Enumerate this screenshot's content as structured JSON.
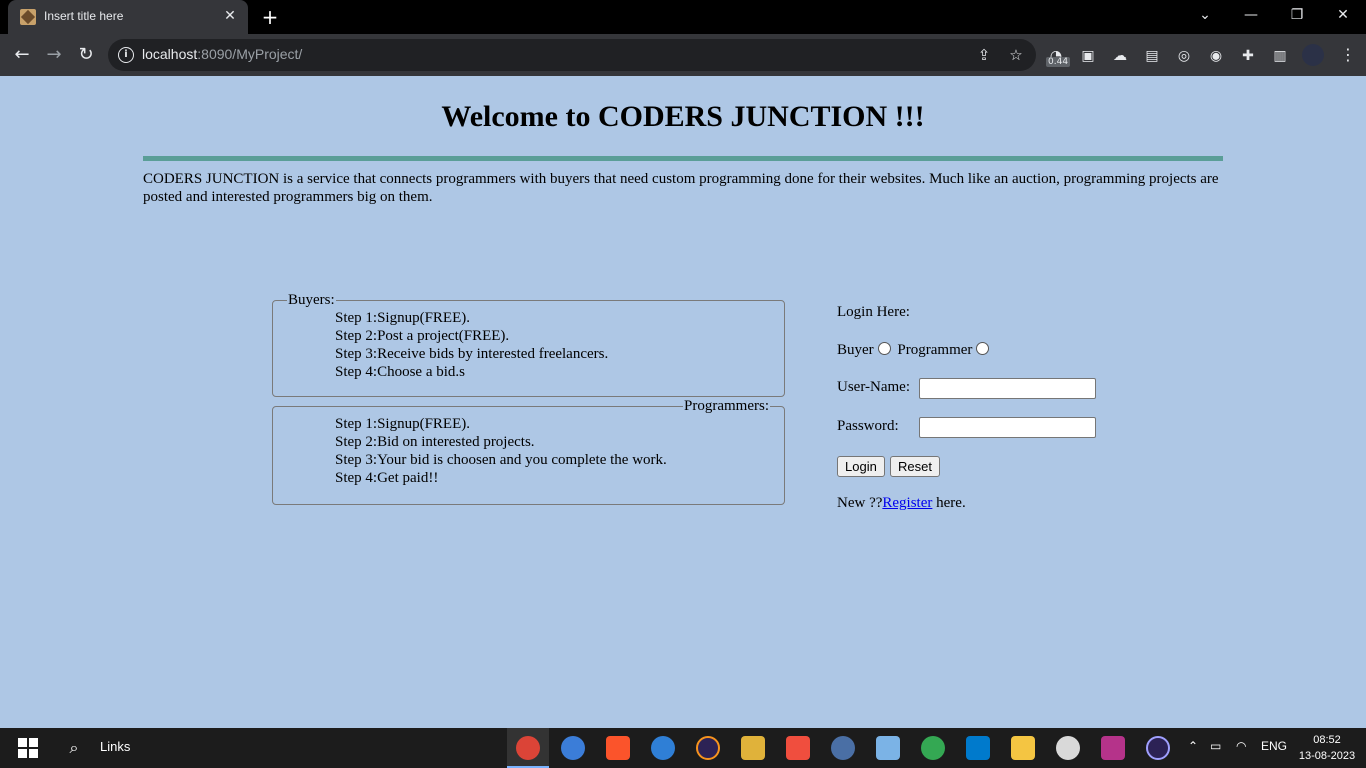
{
  "browser": {
    "tab_title": "Insert title here",
    "url_host": "localhost",
    "url_rest": ":8090/MyProject/",
    "extension_badge": "0.44"
  },
  "page": {
    "heading": "Welcome to CODERS JUNCTION !!!",
    "intro": "CODERS JUNCTION is a service that connects programmers with buyers that need custom programming done for their websites. Much like an auction, programming projects are posted and interested programmers big on them.",
    "buyers": {
      "legend": "Buyers:",
      "steps": [
        "Step 1:Signup(FREE).",
        "Step 2:Post a project(FREE).",
        "Step 3:Receive bids by interested freelancers.",
        "Step 4:Choose a bid.s"
      ]
    },
    "programmers": {
      "legend": "Programmers:",
      "steps": [
        "Step 1:Signup(FREE).",
        "Step 2:Bid on interested projects.",
        "Step 3:Your bid is choosen and you complete the work.",
        "Step 4:Get paid!!"
      ]
    },
    "login": {
      "title": "Login Here:",
      "role_buyer": "Buyer",
      "role_programmer": "Programmer",
      "username_label": "User-Name:",
      "password_label": "Password:",
      "username_value": "",
      "password_value": "",
      "login_button": "Login",
      "reset_button": "Reset",
      "register_prefix": "New ??",
      "register_link": "Register",
      "register_suffix": " here."
    }
  },
  "taskbar": {
    "links_label": "Links",
    "language": "ENG",
    "time": "08:52",
    "date": "13-08-2023"
  }
}
